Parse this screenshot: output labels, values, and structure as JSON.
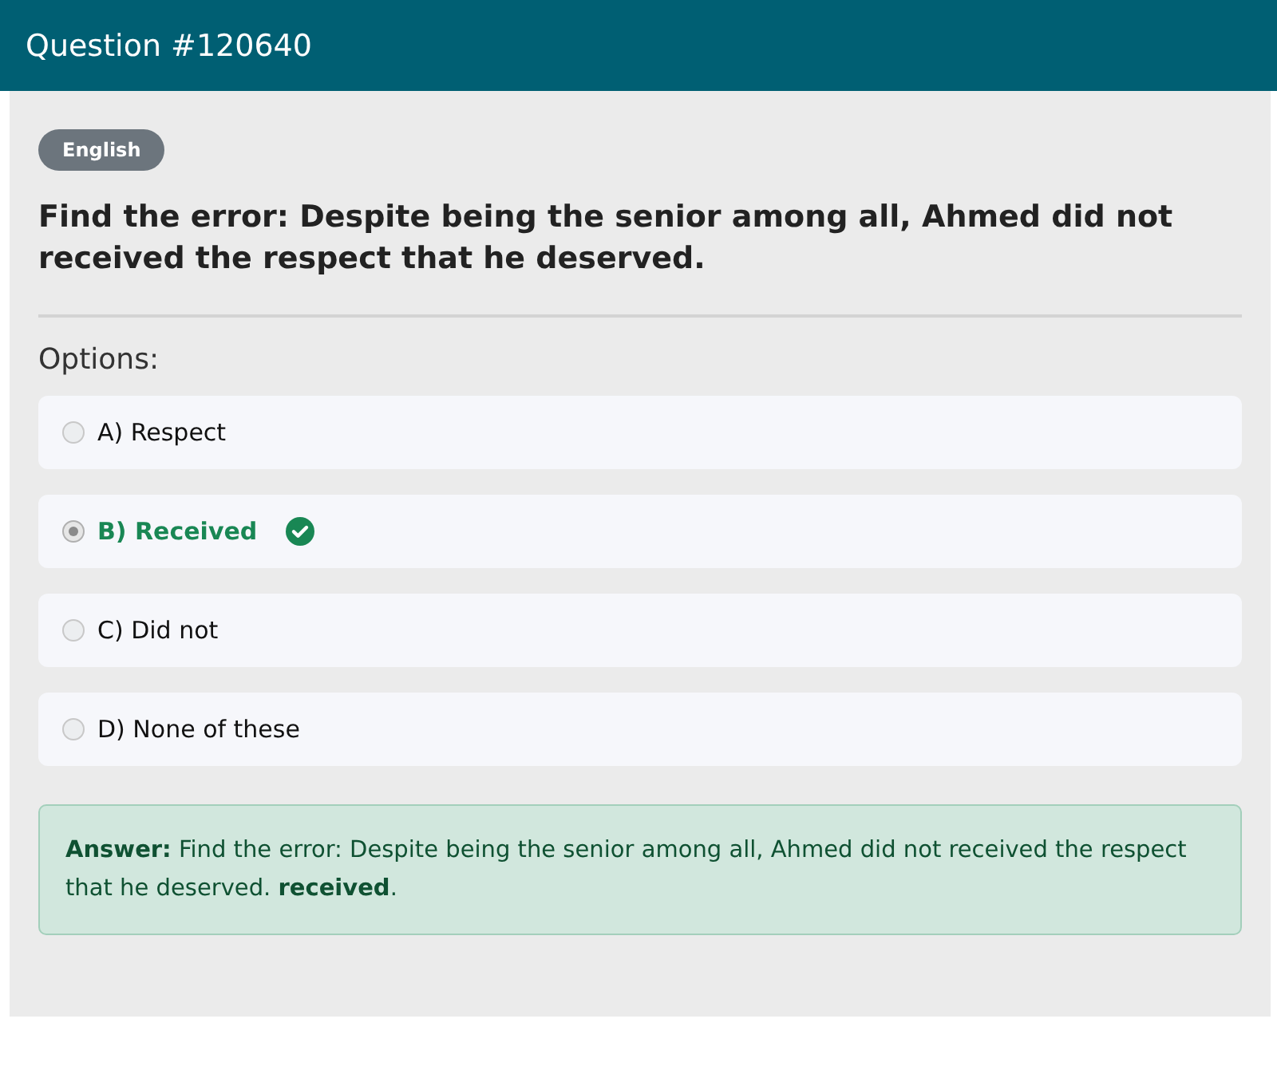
{
  "header": {
    "title": "Question #120640"
  },
  "language_badge": "English",
  "question": "Find the error: Despite being the senior among all, Ahmed did not received the respect that he deserved.",
  "options_label": "Options:",
  "options": [
    {
      "label": "A) Respect",
      "selected": false,
      "correct": false
    },
    {
      "label": "B) Received",
      "selected": true,
      "correct": true
    },
    {
      "label": "C) Did not",
      "selected": false,
      "correct": false
    },
    {
      "label": "D) None of these",
      "selected": false,
      "correct": false
    }
  ],
  "answer": "**Answer:** Find the error: Despite being the senior among all, Ahmed did not received the respect that he deserved. **received**."
}
